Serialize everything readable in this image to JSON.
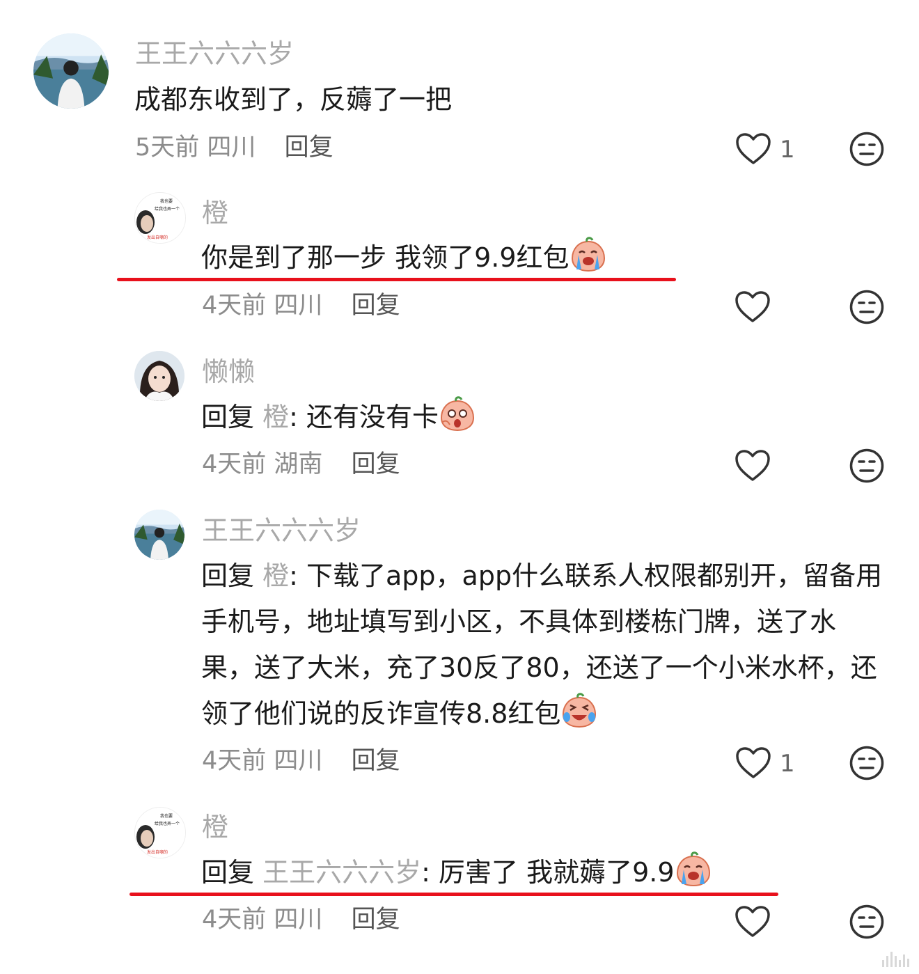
{
  "comments": [
    {
      "username": "王王六六六岁",
      "text": "成都东收到了，反薅了一把",
      "time": "5天前",
      "location": "四川",
      "reply": "回复",
      "likes": "1"
    },
    {
      "username": "橙",
      "text": "你是到了那一步 我领了9.9红包",
      "time": "4天前",
      "location": "四川",
      "reply": "回复",
      "likes": ""
    },
    {
      "username": "懒懒",
      "reply_prefix": "回复",
      "reply_to": "橙",
      "text": ": 还有没有卡",
      "time": "4天前",
      "location": "湖南",
      "reply": "回复",
      "likes": ""
    },
    {
      "username": "王王六六六岁",
      "reply_prefix": "回复",
      "reply_to": "橙",
      "text": ": 下载了app，app什么联系人权限都别开，留备用手机号，地址填写到小区，不具体到楼栋门牌，送了水果，送了大米，充了30反了80，还送了一个小米水杯，还领了他们说的反诈宣传8.8红包",
      "time": "4天前",
      "location": "四川",
      "reply": "回复",
      "likes": "1"
    },
    {
      "username": "橙",
      "reply_prefix": "回复",
      "reply_to": "王王六六六岁",
      "text": ": 厉害了 我就薅了9.9",
      "time": "4天前",
      "location": "四川",
      "reply": "回复",
      "likes": ""
    }
  ],
  "avatar_text": {
    "line1": "我也要",
    "line2": "给我也弄一个",
    "line3": "发出自嘲的"
  },
  "icons": {
    "like": "heart-outline-icon",
    "dislike": "neutral-face-icon",
    "emoji": "peach-emoji"
  },
  "colors": {
    "username": "#a8a8a8",
    "text": "#1a1a1a",
    "underline": "#e8111c"
  }
}
